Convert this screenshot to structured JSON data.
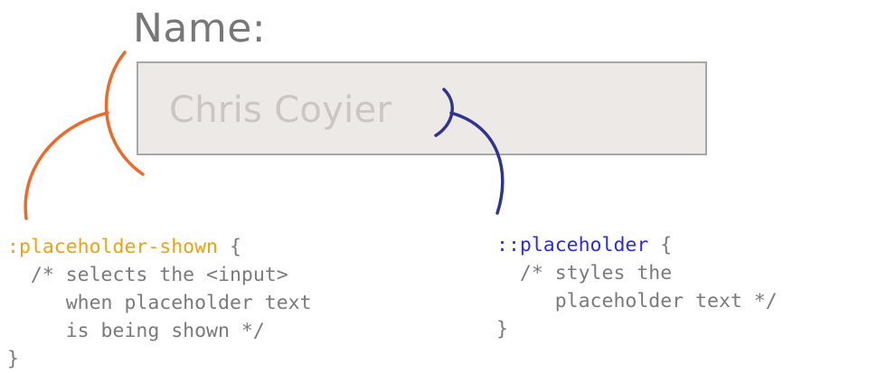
{
  "form": {
    "label": "Name:",
    "input_placeholder": "Chris Coyier"
  },
  "left_snippet": {
    "selector": ":placeholder-shown",
    "open": " {",
    "comment_lines": [
      "  /* selects the <input>",
      "     when placeholder text",
      "     is being shown */"
    ],
    "close": "}"
  },
  "right_snippet": {
    "selector": "::placeholder",
    "open": " {",
    "comment_lines": [
      "  /* styles the",
      "     placeholder text */"
    ],
    "close": "}"
  },
  "colors": {
    "input_bracket": "#ee6a2a",
    "placeholder_bracket": "#2e3590",
    "placeholder_shown_selector": "#f2a20f",
    "placeholder_selector": "#2a2aee",
    "code_text": "#7a7a7a",
    "input_background": "#ede9e6",
    "input_border": "#a9a7a5"
  }
}
